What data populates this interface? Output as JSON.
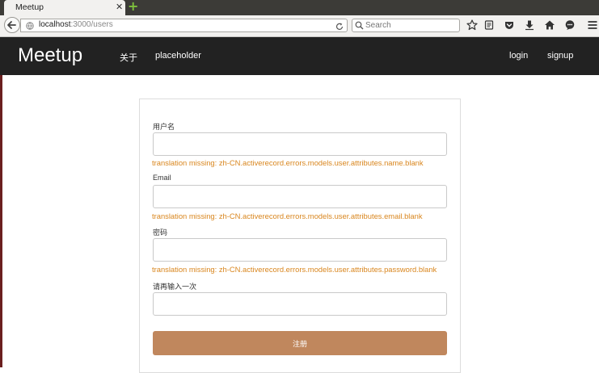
{
  "browser": {
    "tab_title": "Meetup",
    "tab_close": "✕",
    "new_tab": "+",
    "url_host": "localhost",
    "url_path": ":3000/users",
    "search_placeholder": "Search",
    "icons": [
      "back-arrow-icon",
      "globe-icon",
      "reload-icon",
      "search-icon",
      "bookmark-star-icon",
      "reading-list-icon",
      "pocket-icon",
      "download-icon",
      "home-icon",
      "chat-icon",
      "menu-icon"
    ]
  },
  "navbar": {
    "brand": "Meetup",
    "links": [
      "关于",
      "placeholder"
    ],
    "right_links": [
      "login",
      "signup"
    ],
    "background": "#222222"
  },
  "form": {
    "fields": [
      {
        "label": "用户名",
        "value": "",
        "error": "translation missing: zh-CN.activerecord.errors.models.user.attributes.name.blank"
      },
      {
        "label": "Email",
        "value": "",
        "error": "translation missing: zh-CN.activerecord.errors.models.user.attributes.email.blank"
      },
      {
        "label": "密码",
        "value": "",
        "error": "translation missing: zh-CN.activerecord.errors.models.user.attributes.password.blank"
      },
      {
        "label": "请再输入一次",
        "value": ""
      }
    ],
    "submit_label": "注册",
    "error_color": "#d9861e",
    "button_color": "#c0875d"
  }
}
